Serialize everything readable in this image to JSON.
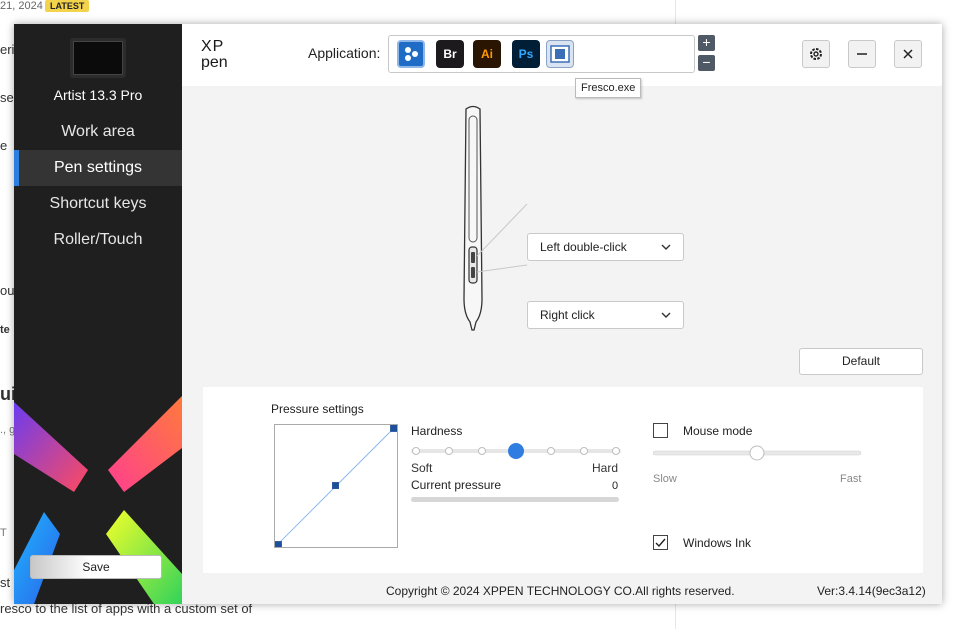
{
  "background_page": {
    "date_fragment": "21, 2024",
    "badge": "LATEST",
    "fragments": [
      "eri",
      "se",
      "e",
      "ou",
      "te",
      "ui",
      "., g",
      "T",
      "st c",
      "resco to the list of apps with a custom set of"
    ]
  },
  "sidebar": {
    "device_name": "Artist 13.3 Pro",
    "items": [
      {
        "label": "Work area"
      },
      {
        "label": "Pen settings"
      },
      {
        "label": "Shortcut keys"
      },
      {
        "label": "Roller/Touch"
      }
    ],
    "save_label": "Save"
  },
  "topbar": {
    "application_label": "Application:",
    "apps": [
      {
        "name": "xppen-all-apps",
        "text": ""
      },
      {
        "name": "bridge",
        "text": "Br"
      },
      {
        "name": "illustrator",
        "text": "Ai"
      },
      {
        "name": "photoshop",
        "text": "Ps"
      },
      {
        "name": "fresco",
        "text": ""
      }
    ],
    "plus": "+",
    "minus": "−",
    "tooltip": "Fresco.exe",
    "icons": {
      "settings": "gear-icon",
      "minimize": "minimize-icon",
      "close": "close-icon"
    }
  },
  "pen": {
    "upper_button": "Left double-click",
    "lower_button": "Right click",
    "default_label": "Default"
  },
  "pressure": {
    "title": "Pressure settings",
    "hardness_label": "Hardness",
    "hardness_level": 0.5,
    "soft_label": "Soft",
    "hard_label": "Hard",
    "current_pressure_label": "Current pressure",
    "current_pressure_value": "0",
    "mouse_mode_label": "Mouse mode",
    "mouse_mode_checked": false,
    "mouse_speed_level": 0.5,
    "slow_label": "Slow",
    "fast_label": "Fast",
    "windows_ink_label": "Windows Ink",
    "windows_ink_checked": true
  },
  "footer": {
    "copyright": "Copyright © 2024  XPPEN TECHNOLOGY CO.All rights reserved.",
    "version": "Ver:3.4.14(9ec3a12)"
  },
  "colors": {
    "sidebar_bg": "#1f1f1f",
    "accent_blue": "#2b7fe0",
    "slider_knob": "#2f7de1",
    "curve_line": "#8db9ef",
    "curve_point": "#1d4f9a"
  }
}
